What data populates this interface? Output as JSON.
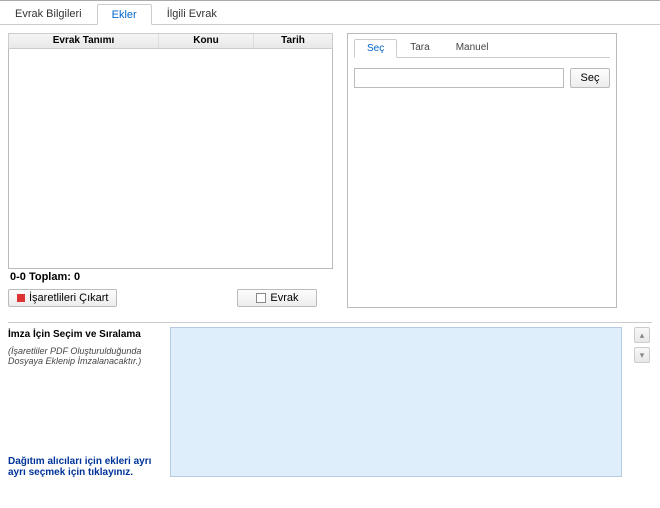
{
  "topTabs": {
    "t1": "Evrak Bilgileri",
    "t2": "Ekler",
    "t3": "İlgili Evrak"
  },
  "cols": {
    "c1": "Evrak Tanımı",
    "c2": "Konu",
    "c3": "Tarih"
  },
  "total": "0-0 Toplam: 0",
  "btns": {
    "remove": "İşaretlileri Çıkart",
    "evrak": "Evrak"
  },
  "rtabs": {
    "r1": "Seç",
    "r2": "Tara",
    "r3": "Manuel"
  },
  "search": {
    "ph": "",
    "btn": "Seç"
  },
  "sig": {
    "title": "İmza İçin Seçim ve Sıralama",
    "note": "(İşaretliler PDF Oluşturulduğunda Dosyaya Eklenip İmzalanacaktır.)",
    "link": "Dağıtım alıcıları için ekleri ayrı ayrı seçmek için tıklayınız."
  },
  "arrows": {
    "up": "▴",
    "down": "▾"
  }
}
